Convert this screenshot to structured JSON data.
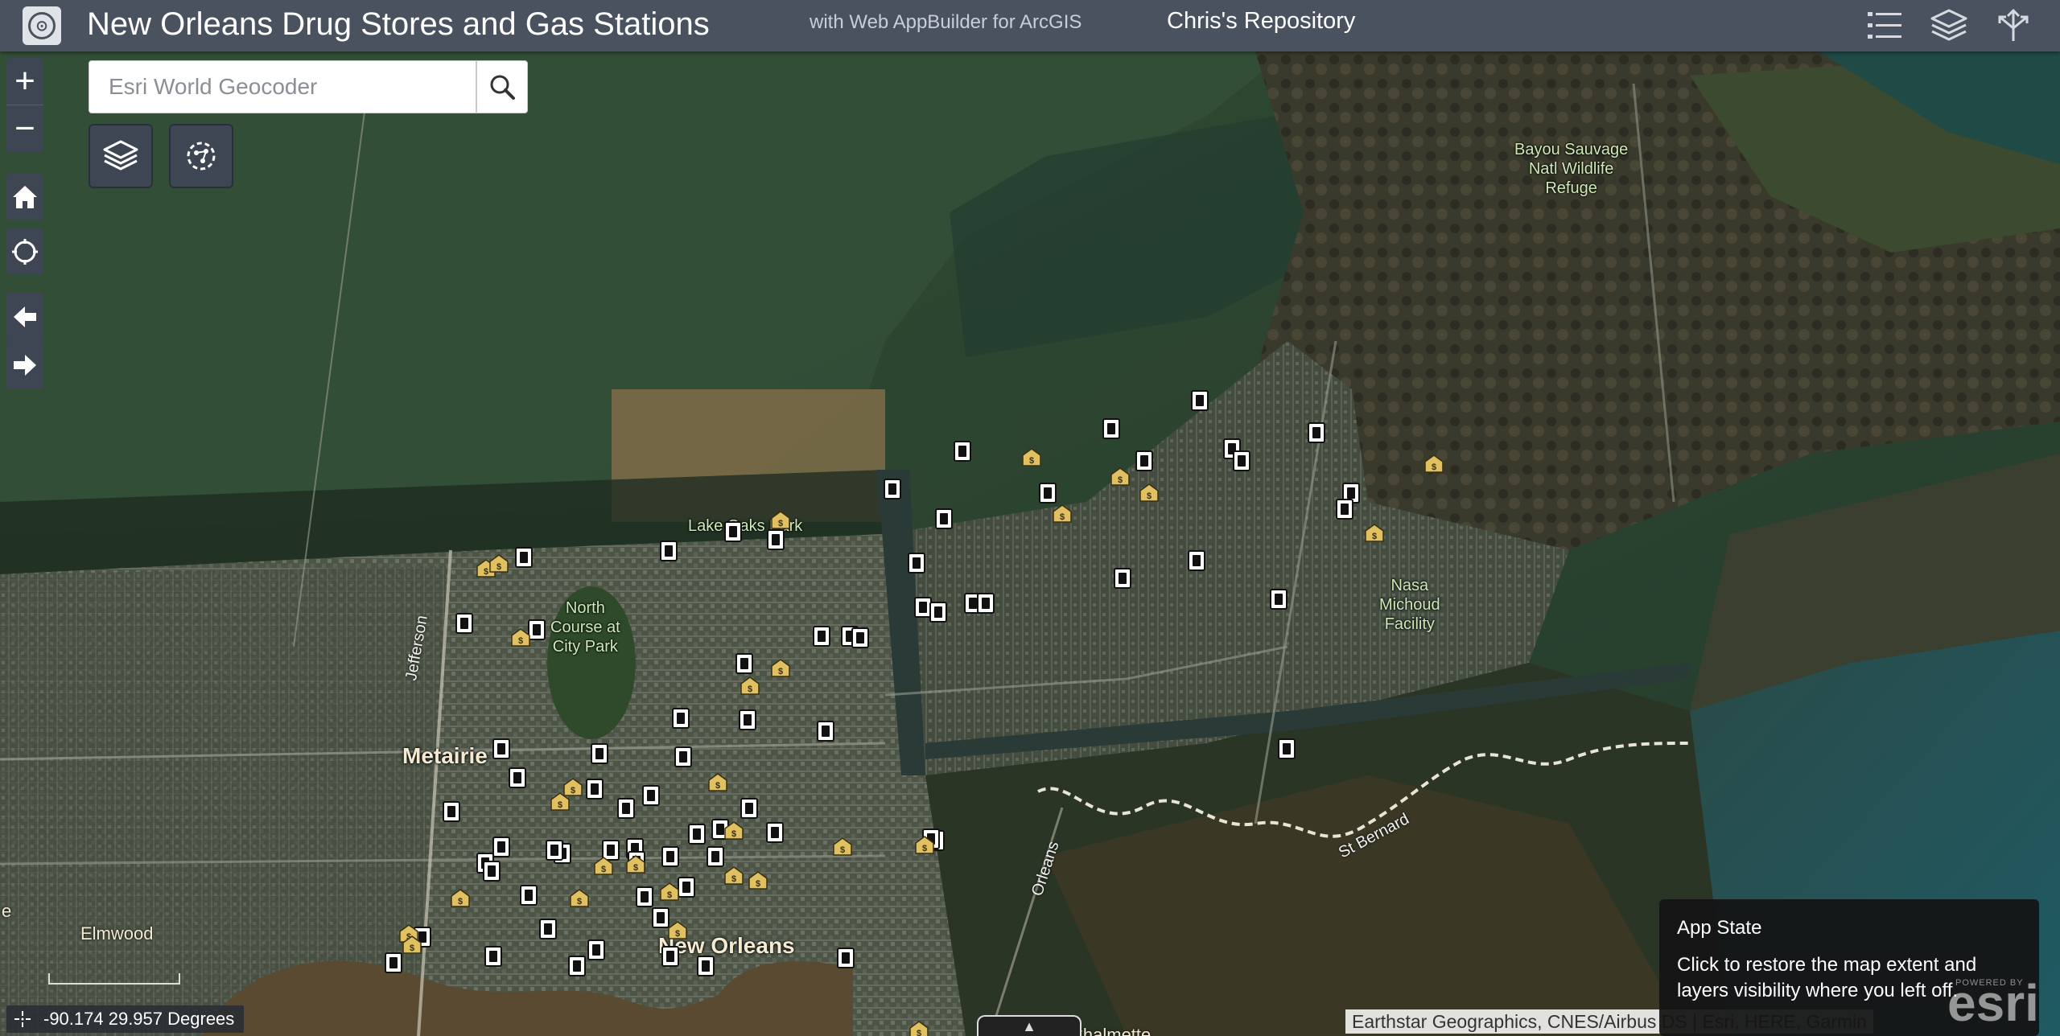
{
  "header": {
    "title": "New Orleans Drug Stores and Gas Stations",
    "subtitle": "with Web AppBuilder for ArcGIS",
    "owner": "Chris's Repository",
    "buttons": [
      {
        "icon": "list-icon"
      },
      {
        "icon": "layers-icon"
      },
      {
        "icon": "share-icon"
      }
    ]
  },
  "search": {
    "placeholder": "Esri World Geocoder",
    "icon": "search-icon"
  },
  "controls": {
    "zoom_in": "+",
    "zoom_out": "−",
    "home_icon": "home-icon",
    "locate_icon": "locate-icon",
    "previous_icon": "arrow-left-icon",
    "next_icon": "arrow-right-icon",
    "layer_list_icon": "layers-icon",
    "widget_icon": "analysis-icon"
  },
  "map_labels": {
    "bayou": "Bayou Sauvage\nNatl Wildlife\nRefuge",
    "lake_oaks": "Lake Oaks Park",
    "north_course": "North\nCourse at\nCity Park",
    "nasa": "Nasa\nMichoud\nFacility",
    "metairie": "Metairie",
    "new_orleans": "New Orleans",
    "elmwood": "Elmwood",
    "jefferson": "Jefferson",
    "orleans": "Orleans",
    "st_bernard": "St Bernard",
    "chalmette": "Chalmette",
    "edge_e": "e"
  },
  "coordinates": {
    "text": "-90.174 29.957 Degrees",
    "icon": "crosshair-icon"
  },
  "attribution": "Earthstar Geographics, CNES/Airbus DS | Esri, HERE, Garmin",
  "app_state_tooltip": {
    "title": "App State",
    "body": "Click to restore the map extent and layers visibility where you left off."
  },
  "esri_logo": "esri",
  "esri_powered": "POWERED BY",
  "legend_colors": {
    "gas_station": "#ffffff",
    "drug_store": "#e0c060"
  }
}
